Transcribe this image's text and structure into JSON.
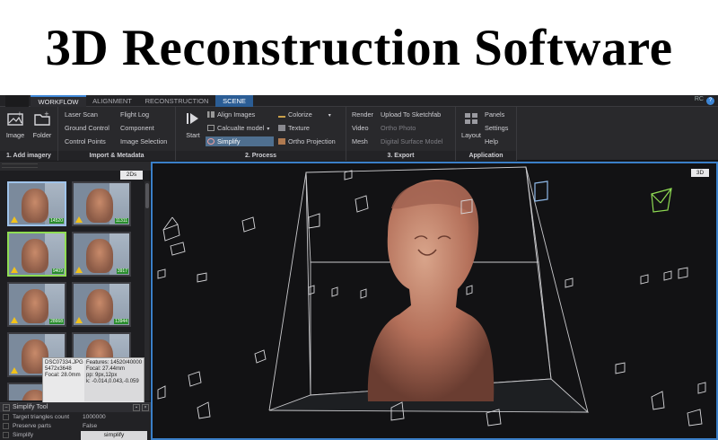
{
  "page_title": "3D Reconstruction Software",
  "tabs": [
    "WORKFLOW",
    "ALIGNMENT",
    "RECONSTRUCTION",
    "SCENE"
  ],
  "user_initials": "RC",
  "help": "?",
  "ribbon": {
    "add_imagery": {
      "label": "1. Add imagery",
      "image": "Image",
      "folder": "Folder"
    },
    "import": {
      "label": "Import & Metadata",
      "col1": [
        "Laser Scan",
        "Ground Control",
        "Control Points"
      ],
      "col2": [
        "Flight Log",
        "Component",
        "Image Selection"
      ]
    },
    "process": {
      "label": "2. Process",
      "start": "Start",
      "align": "Align Images",
      "calculate": "Calcualte model",
      "simplify": "Simplify",
      "colorize": "Colorize",
      "texture": "Texture",
      "ortho": "Ortho Projection"
    },
    "export": {
      "label": "3. Export",
      "col1": [
        "Render",
        "Video",
        "Mesh"
      ],
      "col2": [
        "Upload To Sketchfab",
        "Ortho Photo",
        "Digital Surface Model"
      ]
    },
    "application": {
      "label": "Application",
      "layout": "Layout",
      "items": [
        "Panels",
        "Settings",
        "Help"
      ]
    }
  },
  "left_panel": {
    "view_badge": "2Ds",
    "thumbnail_counts": [
      "14520",
      "11311",
      "9409",
      "3917",
      "28668",
      "13944",
      "",
      ""
    ]
  },
  "tooltip": {
    "name": "DSC07334.JPG",
    "size": "5472x3648",
    "focal": "Focal: 28.0mm",
    "features": "Features: 14520/40000",
    "focal2": "Focal: 27.44mm",
    "pp": "pp: 9px,12px",
    "k": "k: -0.014,0.043,-0.059"
  },
  "simplify_tool": {
    "title": "Simplify Tool",
    "rows": [
      {
        "name": "Target triangles count",
        "value": "1000000"
      },
      {
        "name": "Preserve parts",
        "value": "False"
      },
      {
        "name": "Simplify",
        "value": ""
      }
    ],
    "action": "simplify"
  },
  "viewport": {
    "mode_badge": "3D"
  },
  "colors": {
    "accent": "#3d86d6",
    "scene_tab": "#2b5d95",
    "selected_green": "#8fdc53",
    "warning": "#f1c21a"
  }
}
